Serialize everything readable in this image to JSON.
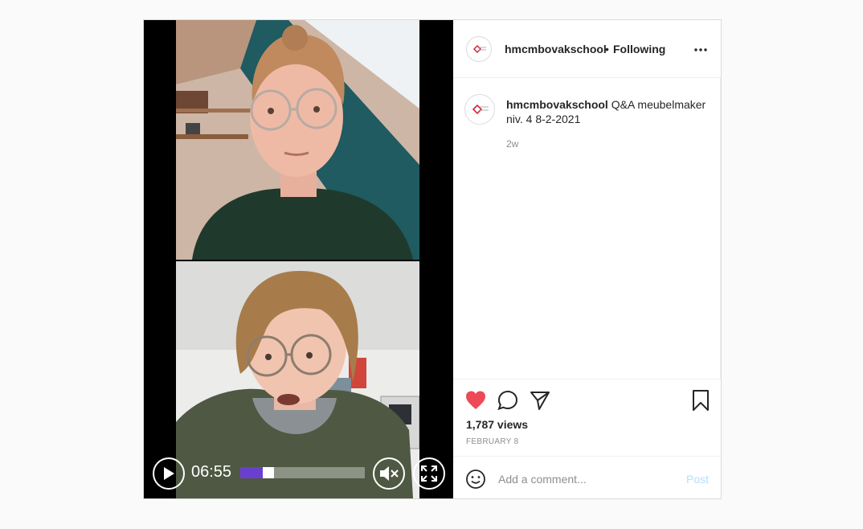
{
  "post": {
    "username": "hmcmbovakschool",
    "follow_sep": "•",
    "follow_status": "Following",
    "caption_user": "hmcmbovakschool",
    "caption_text": "Q&A meubelmaker niv. 4 8-2-2021",
    "time_ago": "2w",
    "views": "1,787 views",
    "date": "FEBRUARY 8",
    "liked": true,
    "like_color": "#ed4956"
  },
  "video": {
    "time": "06:55",
    "progress": 0.18,
    "buffered": 0.28,
    "progress_color": "#6a3fd0",
    "muted": true
  },
  "comment": {
    "placeholder": "Add a comment...",
    "post_label": "Post"
  },
  "icons": {
    "header_more": "more-icon",
    "like": "heart-icon",
    "comment": "comment-icon",
    "share": "share-icon",
    "save": "bookmark-icon",
    "emoji": "emoji-icon",
    "play": "play-icon",
    "mute": "mute-icon",
    "fullscreen": "fullscreen-icon"
  }
}
